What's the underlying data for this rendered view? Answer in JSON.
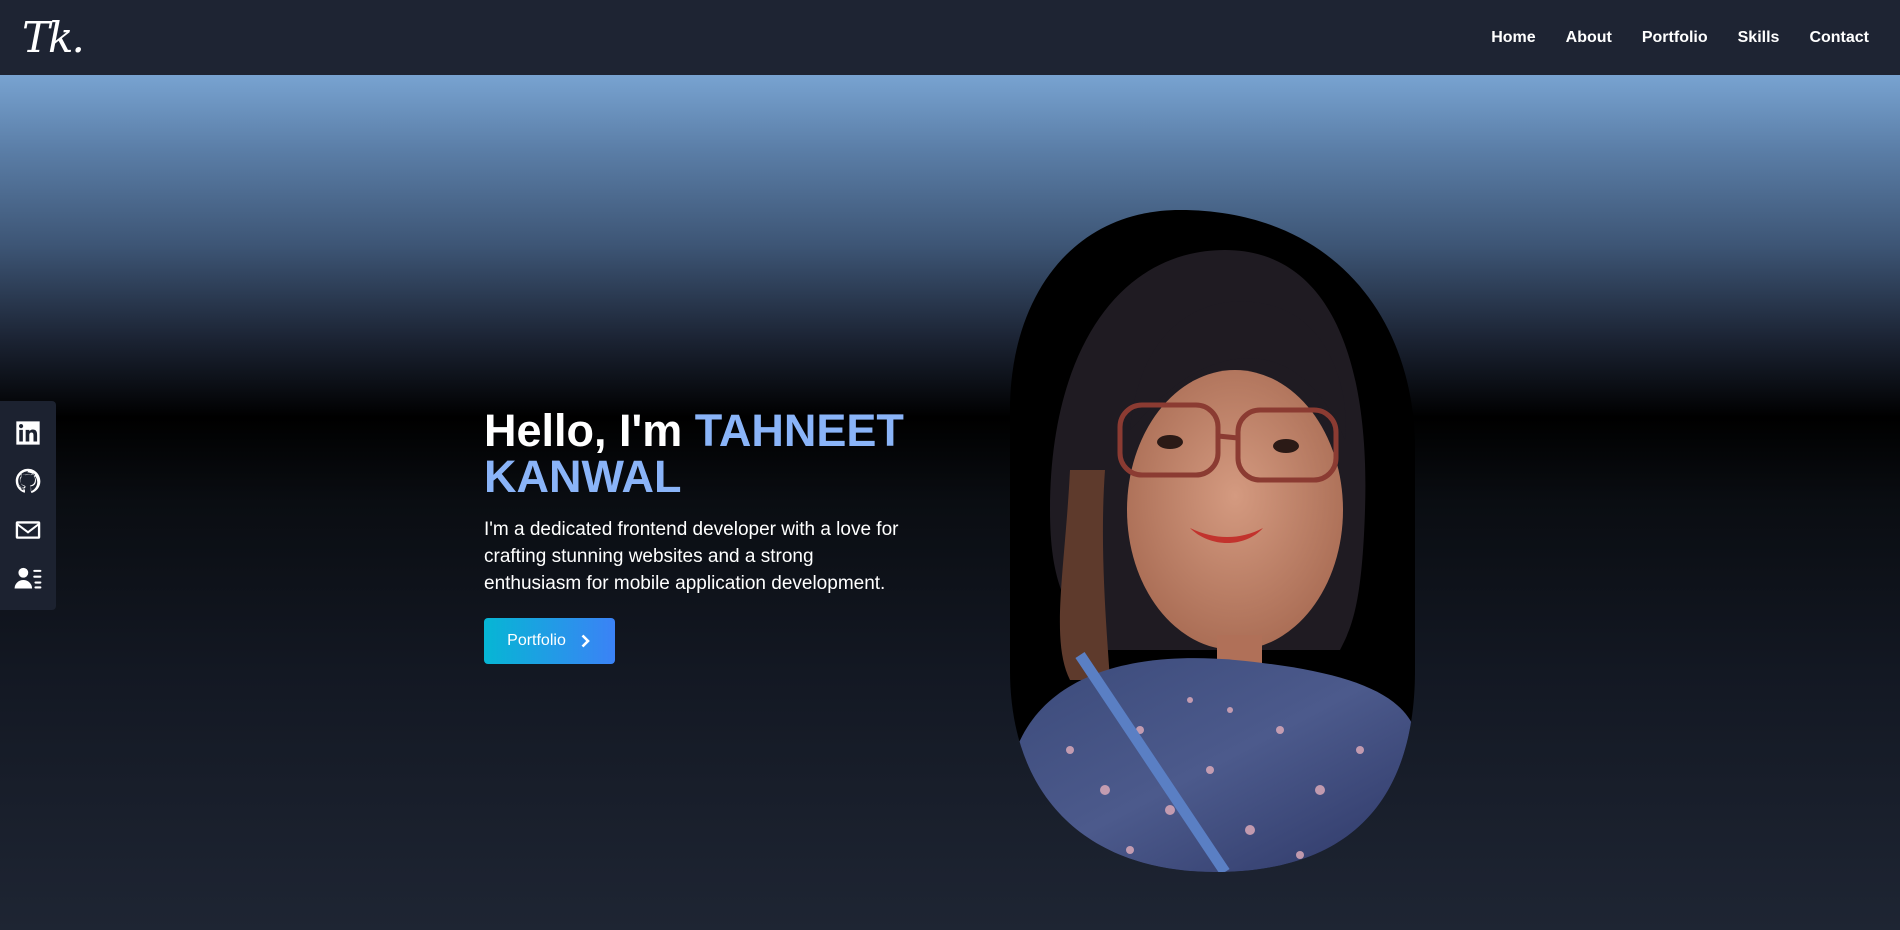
{
  "header": {
    "logo_text": "Tk.",
    "nav": [
      {
        "label": "Home"
      },
      {
        "label": "About"
      },
      {
        "label": "Portfolio"
      },
      {
        "label": "Skills"
      },
      {
        "label": "Contact"
      }
    ]
  },
  "social": [
    {
      "icon": "linkedin-icon"
    },
    {
      "icon": "github-icon"
    },
    {
      "icon": "mail-icon"
    },
    {
      "icon": "resume-icon"
    }
  ],
  "hero": {
    "greeting": "Hello, I'm ",
    "name": "TAHNEET KANWAL",
    "tagline": "I'm a dedicated frontend developer with a love for crafting stunning websites and a strong enthusiasm for mobile application development.",
    "button_label": "Portfolio",
    "button_icon": "chevron-right-icon"
  },
  "colors": {
    "nav_background": "#1e2433",
    "name_accent": "#8ab4f8",
    "button_gradient_start": "#06b6d4",
    "button_gradient_end": "#3b82f6"
  }
}
